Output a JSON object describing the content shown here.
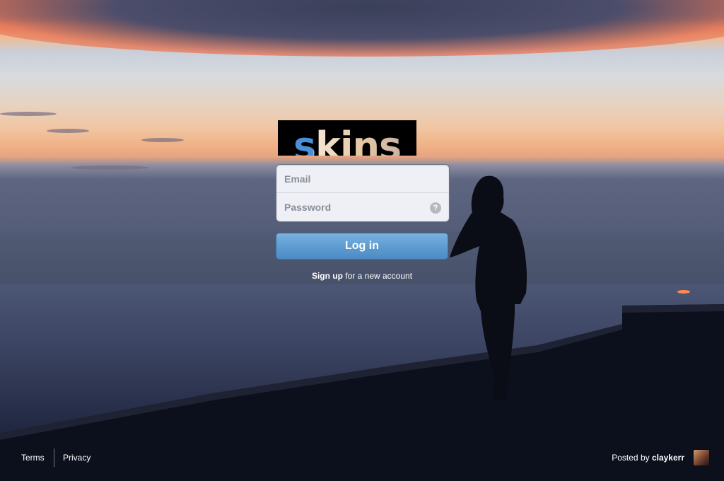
{
  "brand": {
    "logo_text": "skins"
  },
  "login": {
    "email_placeholder": "Email",
    "password_placeholder": "Password",
    "help_glyph": "?",
    "submit_label": "Log in"
  },
  "signup": {
    "link_label": "Sign up",
    "suffix": " for a new account"
  },
  "footer": {
    "terms_label": "Terms",
    "privacy_label": "Privacy",
    "posted_prefix": "Posted by ",
    "posted_user": "claykerr"
  },
  "icons": {
    "help": "question-circle-icon",
    "avatar": "user-avatar"
  },
  "colors": {
    "button": "#5c9bd0",
    "form_bg": "#eef0f6"
  }
}
